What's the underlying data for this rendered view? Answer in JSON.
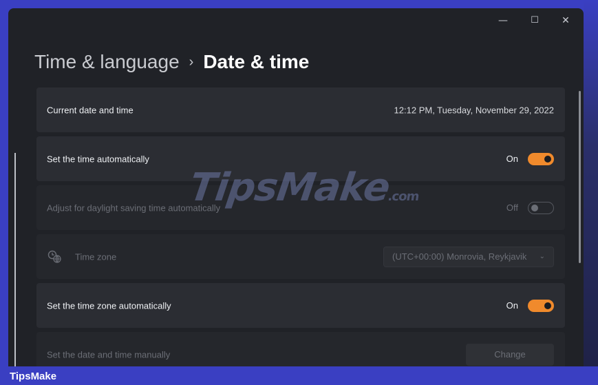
{
  "window": {
    "controls": {
      "minimize": "—",
      "maximize": "☐",
      "close": "✕"
    }
  },
  "breadcrumb": {
    "parent": "Time & language",
    "separator": "›",
    "current": "Date & time"
  },
  "settings": {
    "current_datetime": {
      "label": "Current date and time",
      "value": "12:12 PM, Tuesday, November 29, 2022"
    },
    "auto_time": {
      "label": "Set the time automatically",
      "state": "On"
    },
    "daylight": {
      "label": "Adjust for daylight saving time automatically",
      "state": "Off"
    },
    "time_zone": {
      "label": "Time zone",
      "value": "(UTC+00:00) Monrovia, Reykjavik",
      "icon": "globe-clock-icon"
    },
    "auto_timezone": {
      "label": "Set the time zone automatically",
      "state": "On"
    },
    "manual": {
      "label": "Set the date and time manually",
      "button": "Change"
    }
  },
  "watermark": {
    "text": "TipsMake",
    "suffix": ".com"
  },
  "footer": {
    "brand": "TipsMake"
  },
  "colors": {
    "accent": "#f08a2c",
    "background": "#202227",
    "card": "#2b2d33",
    "banner": "#3a3fc2"
  }
}
